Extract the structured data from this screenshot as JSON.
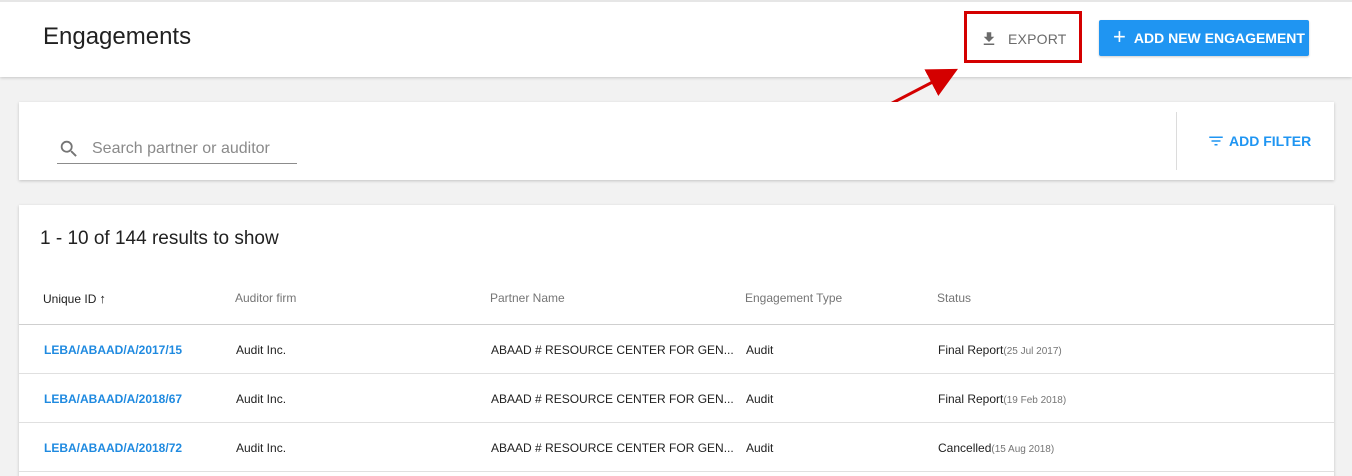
{
  "header": {
    "title": "Engagements",
    "export_label": "EXPORT",
    "add_label": "ADD NEW ENGAGEMENT"
  },
  "filter": {
    "search_placeholder": "Search partner or auditor",
    "add_filter_label": "ADD FILTER"
  },
  "results": {
    "count_text": "1 - 10 of 144 results to show",
    "columns": [
      "Unique ID",
      "Auditor firm",
      "Partner Name",
      "Engagement Type",
      "Status"
    ],
    "sort_indicator": "↑",
    "rows": [
      {
        "id": "LEBA/ABAAD/A/2017/15",
        "firm": "Audit Inc.",
        "partner": "ABAAD # RESOURCE CENTER FOR GEN...",
        "type": "Audit",
        "status": "Final Report",
        "date": "(25 Jul 2017)"
      },
      {
        "id": "LEBA/ABAAD/A/2018/67",
        "firm": "Audit Inc.",
        "partner": "ABAAD # RESOURCE CENTER FOR GEN...",
        "type": "Audit",
        "status": "Final Report",
        "date": "(19 Feb 2018)"
      },
      {
        "id": "LEBA/ABAAD/A/2018/72",
        "firm": "Audit Inc.",
        "partner": "ABAAD # RESOURCE CENTER FOR GEN...",
        "type": "Audit",
        "status": "Cancelled",
        "date": "(15 Aug 2018)"
      }
    ]
  },
  "colors": {
    "accent": "#1f95f2",
    "annotation": "#d40000"
  },
  "icons": {
    "export": "download-icon",
    "add": "plus-icon",
    "search": "search-icon",
    "filter": "filter-icon",
    "sort": "arrow-up-icon"
  }
}
